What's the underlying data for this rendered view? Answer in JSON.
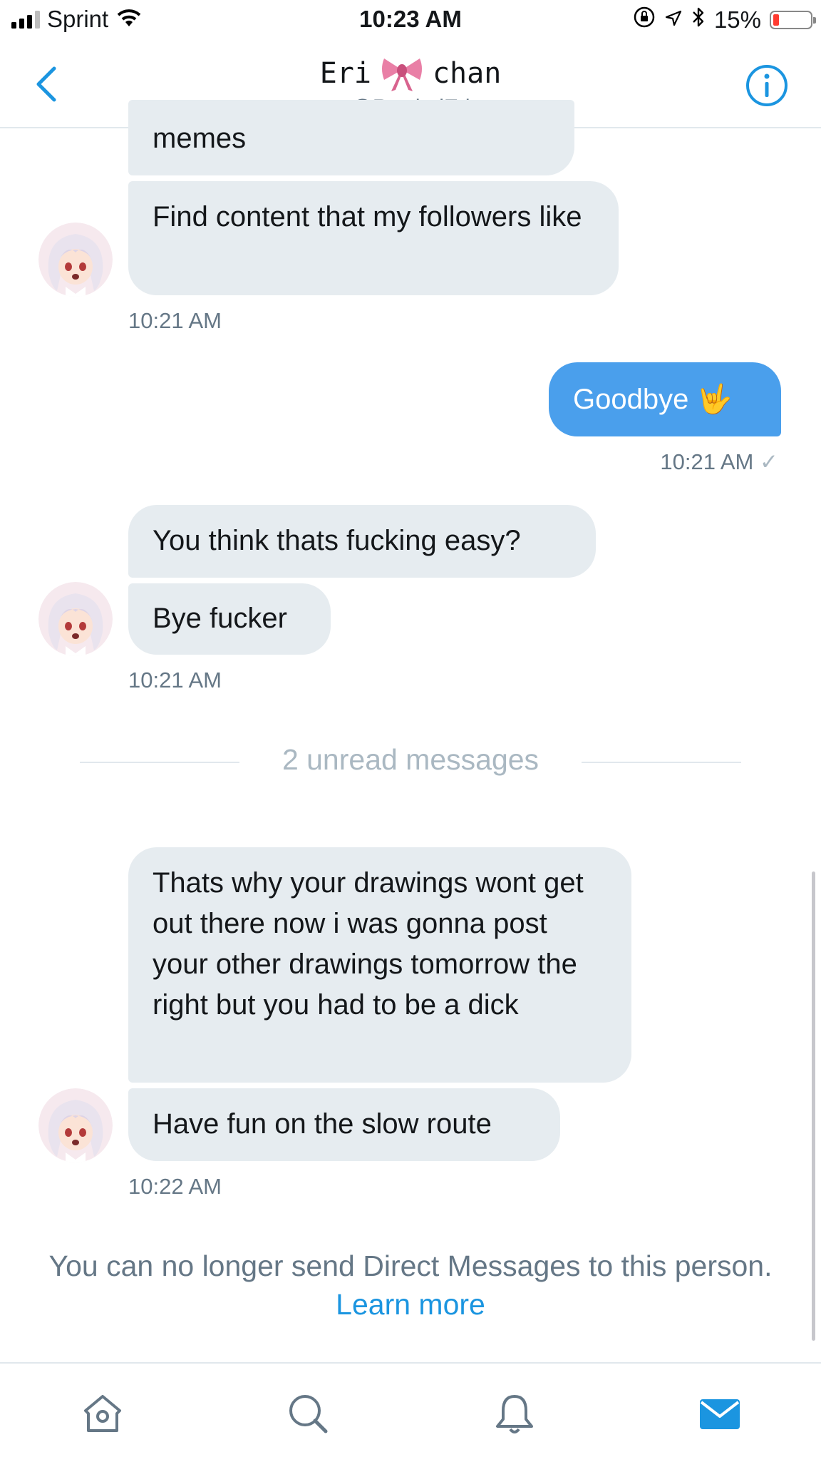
{
  "status_bar": {
    "carrier": "Sprint",
    "time": "10:23 AM",
    "battery": "15%",
    "battery_level": 0.15
  },
  "header": {
    "name_left": "Eri",
    "name_right": "chan",
    "handle": "@RewindEri",
    "icons": {
      "back": "chevron-left-icon",
      "info": "info-icon",
      "bow": "bow-emoji"
    }
  },
  "messages": [
    {
      "text": "memes",
      "from": "them"
    },
    {
      "text": "Find content that my followers like",
      "from": "them"
    },
    {
      "time": "10:21 AM"
    },
    {
      "text": "Goodbye 🤟",
      "from": "me"
    },
    {
      "time": "10:21 AM",
      "receipt": "✓"
    },
    {
      "text": "You think thats fucking easy?",
      "from": "them"
    },
    {
      "text": "Bye fucker",
      "from": "them"
    },
    {
      "time": "10:21 AM"
    },
    {
      "text": "Thats why your drawings wont get out there now i was gonna post your other drawings tomorrow the right but you had to be a dick",
      "from": "them"
    },
    {
      "text": "Have fun on the slow route",
      "from": "them"
    },
    {
      "time": "10:22 AM"
    }
  ],
  "unread_label": "2 unread messages",
  "notice": {
    "text": "You can no longer send Direct Messages to this person.",
    "link": "Learn more"
  },
  "tab_bar": {
    "items": [
      "home-icon",
      "search-icon",
      "notifications-icon",
      "messages-icon"
    ],
    "active": "messages-icon"
  },
  "colors": {
    "accent": "#1b95e0",
    "sent_bubble": "#4a9fec",
    "received_bubble": "#e6ecf0",
    "secondary_text": "#657786"
  }
}
